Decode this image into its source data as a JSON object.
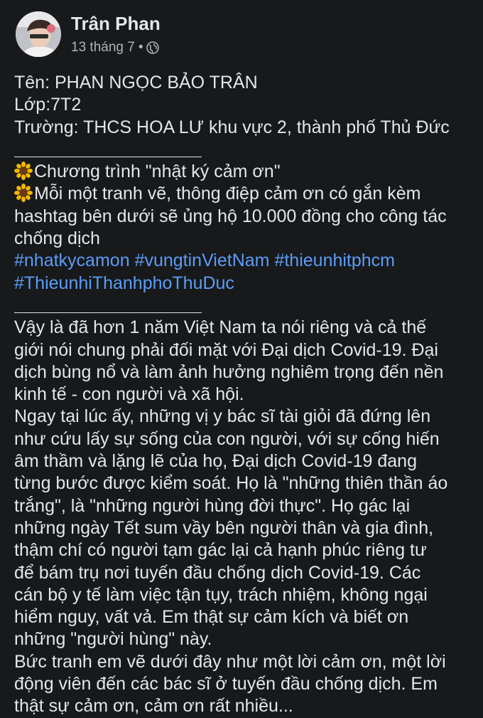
{
  "author": {
    "name": "Trân Phan",
    "date": "13 tháng 7",
    "separator": "•",
    "privacy_icon": "globe-icon"
  },
  "colors": {
    "background": "#18191a",
    "text": "#e4e6eb",
    "secondary_text": "#b0b3b8",
    "hashtag": "#5b9cf8"
  },
  "post": {
    "info": {
      "name_line": "Tên: PHAN NGỌC BẢO TRÂN",
      "class_line": "Lớp:7T2",
      "school_line": "Trường: THCS HOA LƯ khu vực 2, thành phố Thủ Đức"
    },
    "program": {
      "icon": "sunflower-icon",
      "line1": "Chương trình \"nhật ký cảm ơn\"",
      "line2a": "Mỗi một tranh vẽ, thông điệp cảm ơn có gắn kèm",
      "line2b": "hashtag bên dưới sẽ ủng hộ 10.000 đồng cho công tác",
      "line2c": "chống dịch"
    },
    "hashtags": [
      "#nhatkycamon",
      "#vungtinVietNam",
      "#thieunhitphcm",
      "#ThieunhiThanhphoThuDuc"
    ],
    "story_lines": [
      "Vậy là đã hơn 1 năm Việt Nam ta nói riêng và cả thế",
      "giới nói chung phải đối mặt với Đại dịch Covid-19. Đại",
      "dịch bùng nổ và làm ảnh hưởng nghiêm trọng đến nền",
      "kinh tế - con người và xã hội.",
      "Ngay tại lúc ấy, những vị y bác sĩ tài giỏi đã đứng lên",
      "như cứu lấy sự sống của con người, với sự cống hiến",
      "âm thầm và lặng lẽ của họ, Đại dịch Covid-19 đang",
      "từng bước được kiểm soát. Họ là \"những thiên thần áo",
      "trắng\",  là \"những người hùng đời thực\". Họ gác lại",
      "những ngày Tết sum vầy bên người thân và gia đình,",
      "thậm chí có người tạm gác lại cả hạnh phúc riêng tư",
      "để bám trụ nơi tuyến đầu chống dịch Covid-19. Các",
      "cán bộ y tế làm việc tận tụy, trách nhiệm, không ngại",
      "hiểm nguy, vất vả. Em thật sự cảm kích và biết ơn",
      "những \"người hùng\" này.",
      "Bức tranh em vẽ dưới đây như một lời cảm ơn, một lời",
      "động viên đến các bác sĩ ở tuyến đầu chống dịch. Em",
      "thật sự cảm ơn, cảm ơn rất nhiều..."
    ]
  }
}
